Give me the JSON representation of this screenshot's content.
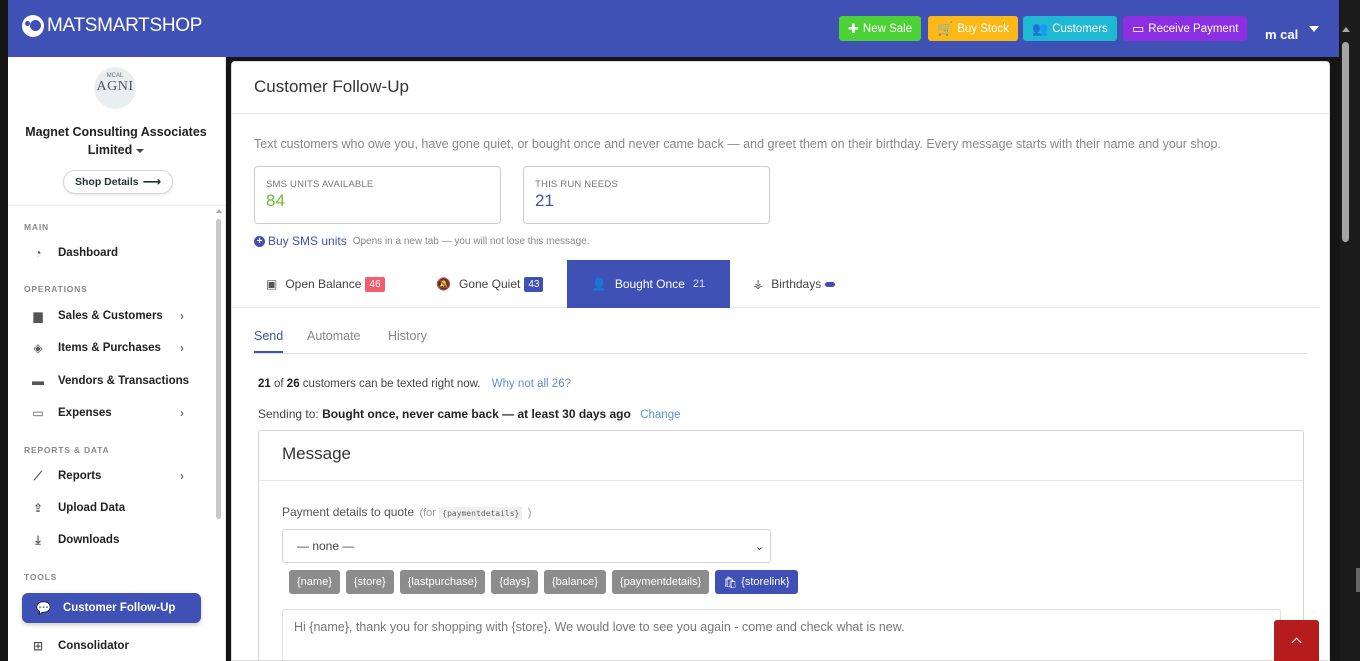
{
  "brand": {
    "name": "MATSMARTSHOP"
  },
  "topbar": {
    "new_sale": "New Sale",
    "buy_stock": "Buy Stock",
    "customers": "Customers",
    "receive_payment": "Receive Payment",
    "user": "m cal"
  },
  "sidebar": {
    "logo_top": "MCAL",
    "logo_main": "AGNI",
    "company": "Magnet Consulting Associates Limited",
    "shop_details": "Shop Details",
    "sections": {
      "main": "MAIN",
      "operations": "OPERATIONS",
      "reports": "REPORTS & DATA",
      "tools": "TOOLS"
    },
    "items": {
      "dashboard": "Dashboard",
      "sales": "Sales & Customers",
      "items": "Items & Purchases",
      "vendors": "Vendors & Transactions",
      "expenses": "Expenses",
      "reports": "Reports",
      "upload": "Upload Data",
      "downloads": "Downloads",
      "followup": "Customer Follow-Up",
      "consolidator": "Consolidator"
    }
  },
  "main": {
    "title": "Customer Follow-Up",
    "intro": "Text customers who owe you, have gone quiet, or bought once and never came back — and greet them on their birthday. Every message starts with their name and your shop.",
    "stats": {
      "sms_label": "SMS UNITS AVAILABLE",
      "sms_value": "84",
      "run_label": "THIS RUN NEEDS",
      "run_value": "21"
    },
    "buy_sms": "Buy SMS units",
    "buy_sms_note": "Opens in a new tab — you will not lose this message.",
    "tabs": {
      "open_balance": "Open Balance",
      "open_balance_count": "46",
      "gone_quiet": "Gone Quiet",
      "gone_quiet_count": "43",
      "bought_once": "Bought Once",
      "bought_once_count": "21",
      "birthdays": "Birthdays"
    },
    "subtabs": {
      "send": "Send",
      "automate": "Automate",
      "history": "History"
    },
    "summary": {
      "can_text": "21",
      "of": "of",
      "total": "26",
      "suffix": "customers can be texted right now.",
      "why": "Why not all 26?",
      "sending_prefix": "Sending to:",
      "sending_target": "Bought once, never came back — at least 30 days ago",
      "change": "Change"
    },
    "message": {
      "title": "Message",
      "pay_label": "Payment details to quote",
      "pay_for": "(for",
      "pay_code": "{paymentdetails}",
      "pay_close": ")",
      "select_value": "— none —",
      "tags": [
        "{name}",
        "{store}",
        "{lastpurchase}",
        "{days}",
        "{balance}",
        "{paymentdetails}"
      ],
      "storelink_tag": "{storelink}",
      "body": "Hi {name}, thank you for shopping with {store}. We would love to see you again - come and check what is new."
    }
  }
}
